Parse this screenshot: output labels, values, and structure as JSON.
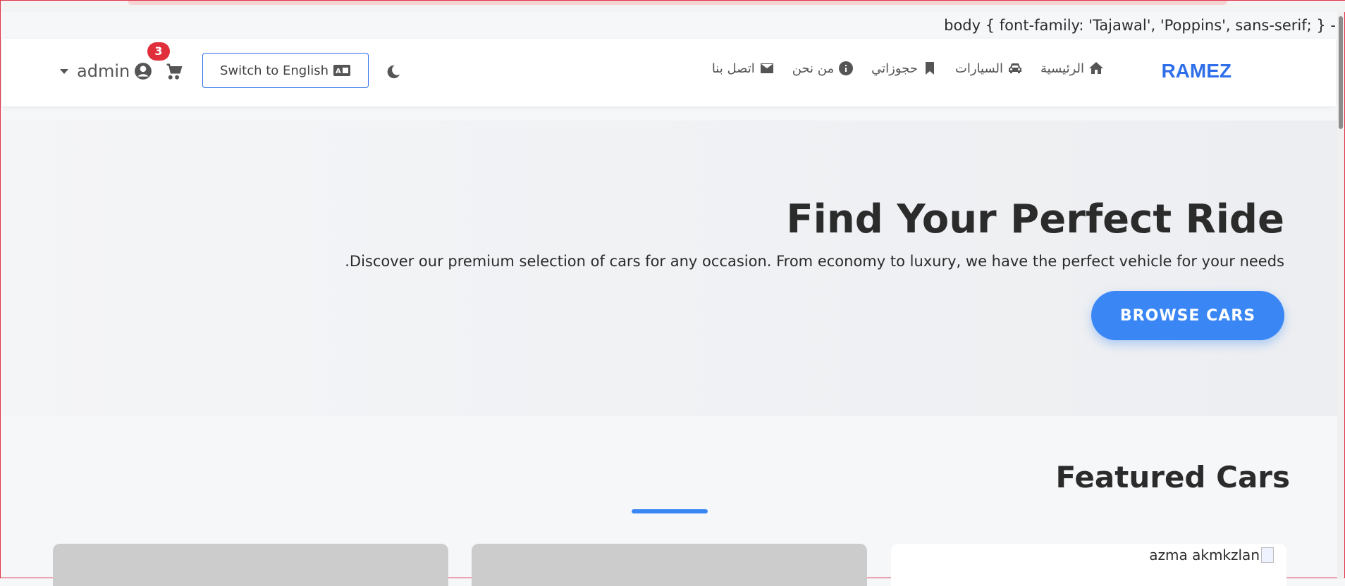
{
  "code_line": "body { font-family: 'Tajawal', 'Poppins', sans-serif; } -",
  "navbar": {
    "brand": "RAMEZ",
    "links": [
      {
        "label": "الرئيسية",
        "icon": "home-icon"
      },
      {
        "label": "السيارات",
        "icon": "car-icon"
      },
      {
        "label": "حجوزاتي",
        "icon": "bookmark-icon"
      },
      {
        "label": "من نحن",
        "icon": "info-icon"
      },
      {
        "label": "اتصل بنا",
        "icon": "envelope-icon"
      }
    ],
    "theme_icon": "moon-icon",
    "lang_button": "Switch to English",
    "cart_count": "3",
    "user_name": "admin"
  },
  "hero": {
    "title": "Find Your Perfect Ride",
    "subtitle": ".Discover our premium selection of cars for any occasion. From economy to luxury, we have the perfect vehicle for your needs",
    "button": "BROWSE CARS"
  },
  "featured": {
    "title": "Featured Cars",
    "cards": [
      {
        "alt": ""
      },
      {
        "alt": ""
      },
      {
        "alt": "azma akmkzlan"
      }
    ]
  },
  "colors": {
    "brand": "#2f6fe9",
    "accent": "#3a86f5",
    "badge": "#e02e3a"
  }
}
